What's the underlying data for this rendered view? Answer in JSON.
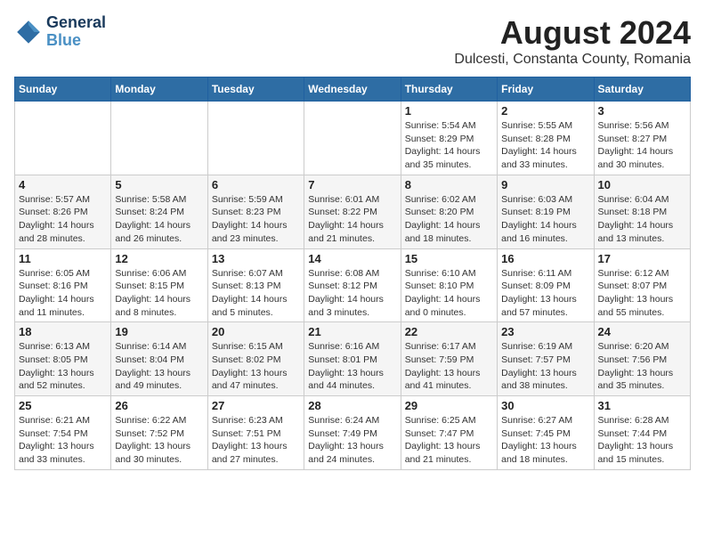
{
  "logo": {
    "line1": "General",
    "line2": "Blue"
  },
  "title": "August 2024",
  "subtitle": "Dulcesti, Constanta County, Romania",
  "weekdays": [
    "Sunday",
    "Monday",
    "Tuesday",
    "Wednesday",
    "Thursday",
    "Friday",
    "Saturday"
  ],
  "weeks": [
    [
      {
        "day": "",
        "info": ""
      },
      {
        "day": "",
        "info": ""
      },
      {
        "day": "",
        "info": ""
      },
      {
        "day": "",
        "info": ""
      },
      {
        "day": "1",
        "info": "Sunrise: 5:54 AM\nSunset: 8:29 PM\nDaylight: 14 hours\nand 35 minutes."
      },
      {
        "day": "2",
        "info": "Sunrise: 5:55 AM\nSunset: 8:28 PM\nDaylight: 14 hours\nand 33 minutes."
      },
      {
        "day": "3",
        "info": "Sunrise: 5:56 AM\nSunset: 8:27 PM\nDaylight: 14 hours\nand 30 minutes."
      }
    ],
    [
      {
        "day": "4",
        "info": "Sunrise: 5:57 AM\nSunset: 8:26 PM\nDaylight: 14 hours\nand 28 minutes."
      },
      {
        "day": "5",
        "info": "Sunrise: 5:58 AM\nSunset: 8:24 PM\nDaylight: 14 hours\nand 26 minutes."
      },
      {
        "day": "6",
        "info": "Sunrise: 5:59 AM\nSunset: 8:23 PM\nDaylight: 14 hours\nand 23 minutes."
      },
      {
        "day": "7",
        "info": "Sunrise: 6:01 AM\nSunset: 8:22 PM\nDaylight: 14 hours\nand 21 minutes."
      },
      {
        "day": "8",
        "info": "Sunrise: 6:02 AM\nSunset: 8:20 PM\nDaylight: 14 hours\nand 18 minutes."
      },
      {
        "day": "9",
        "info": "Sunrise: 6:03 AM\nSunset: 8:19 PM\nDaylight: 14 hours\nand 16 minutes."
      },
      {
        "day": "10",
        "info": "Sunrise: 6:04 AM\nSunset: 8:18 PM\nDaylight: 14 hours\nand 13 minutes."
      }
    ],
    [
      {
        "day": "11",
        "info": "Sunrise: 6:05 AM\nSunset: 8:16 PM\nDaylight: 14 hours\nand 11 minutes."
      },
      {
        "day": "12",
        "info": "Sunrise: 6:06 AM\nSunset: 8:15 PM\nDaylight: 14 hours\nand 8 minutes."
      },
      {
        "day": "13",
        "info": "Sunrise: 6:07 AM\nSunset: 8:13 PM\nDaylight: 14 hours\nand 5 minutes."
      },
      {
        "day": "14",
        "info": "Sunrise: 6:08 AM\nSunset: 8:12 PM\nDaylight: 14 hours\nand 3 minutes."
      },
      {
        "day": "15",
        "info": "Sunrise: 6:10 AM\nSunset: 8:10 PM\nDaylight: 14 hours\nand 0 minutes."
      },
      {
        "day": "16",
        "info": "Sunrise: 6:11 AM\nSunset: 8:09 PM\nDaylight: 13 hours\nand 57 minutes."
      },
      {
        "day": "17",
        "info": "Sunrise: 6:12 AM\nSunset: 8:07 PM\nDaylight: 13 hours\nand 55 minutes."
      }
    ],
    [
      {
        "day": "18",
        "info": "Sunrise: 6:13 AM\nSunset: 8:05 PM\nDaylight: 13 hours\nand 52 minutes."
      },
      {
        "day": "19",
        "info": "Sunrise: 6:14 AM\nSunset: 8:04 PM\nDaylight: 13 hours\nand 49 minutes."
      },
      {
        "day": "20",
        "info": "Sunrise: 6:15 AM\nSunset: 8:02 PM\nDaylight: 13 hours\nand 47 minutes."
      },
      {
        "day": "21",
        "info": "Sunrise: 6:16 AM\nSunset: 8:01 PM\nDaylight: 13 hours\nand 44 minutes."
      },
      {
        "day": "22",
        "info": "Sunrise: 6:17 AM\nSunset: 7:59 PM\nDaylight: 13 hours\nand 41 minutes."
      },
      {
        "day": "23",
        "info": "Sunrise: 6:19 AM\nSunset: 7:57 PM\nDaylight: 13 hours\nand 38 minutes."
      },
      {
        "day": "24",
        "info": "Sunrise: 6:20 AM\nSunset: 7:56 PM\nDaylight: 13 hours\nand 35 minutes."
      }
    ],
    [
      {
        "day": "25",
        "info": "Sunrise: 6:21 AM\nSunset: 7:54 PM\nDaylight: 13 hours\nand 33 minutes."
      },
      {
        "day": "26",
        "info": "Sunrise: 6:22 AM\nSunset: 7:52 PM\nDaylight: 13 hours\nand 30 minutes."
      },
      {
        "day": "27",
        "info": "Sunrise: 6:23 AM\nSunset: 7:51 PM\nDaylight: 13 hours\nand 27 minutes."
      },
      {
        "day": "28",
        "info": "Sunrise: 6:24 AM\nSunset: 7:49 PM\nDaylight: 13 hours\nand 24 minutes."
      },
      {
        "day": "29",
        "info": "Sunrise: 6:25 AM\nSunset: 7:47 PM\nDaylight: 13 hours\nand 21 minutes."
      },
      {
        "day": "30",
        "info": "Sunrise: 6:27 AM\nSunset: 7:45 PM\nDaylight: 13 hours\nand 18 minutes."
      },
      {
        "day": "31",
        "info": "Sunrise: 6:28 AM\nSunset: 7:44 PM\nDaylight: 13 hours\nand 15 minutes."
      }
    ]
  ]
}
